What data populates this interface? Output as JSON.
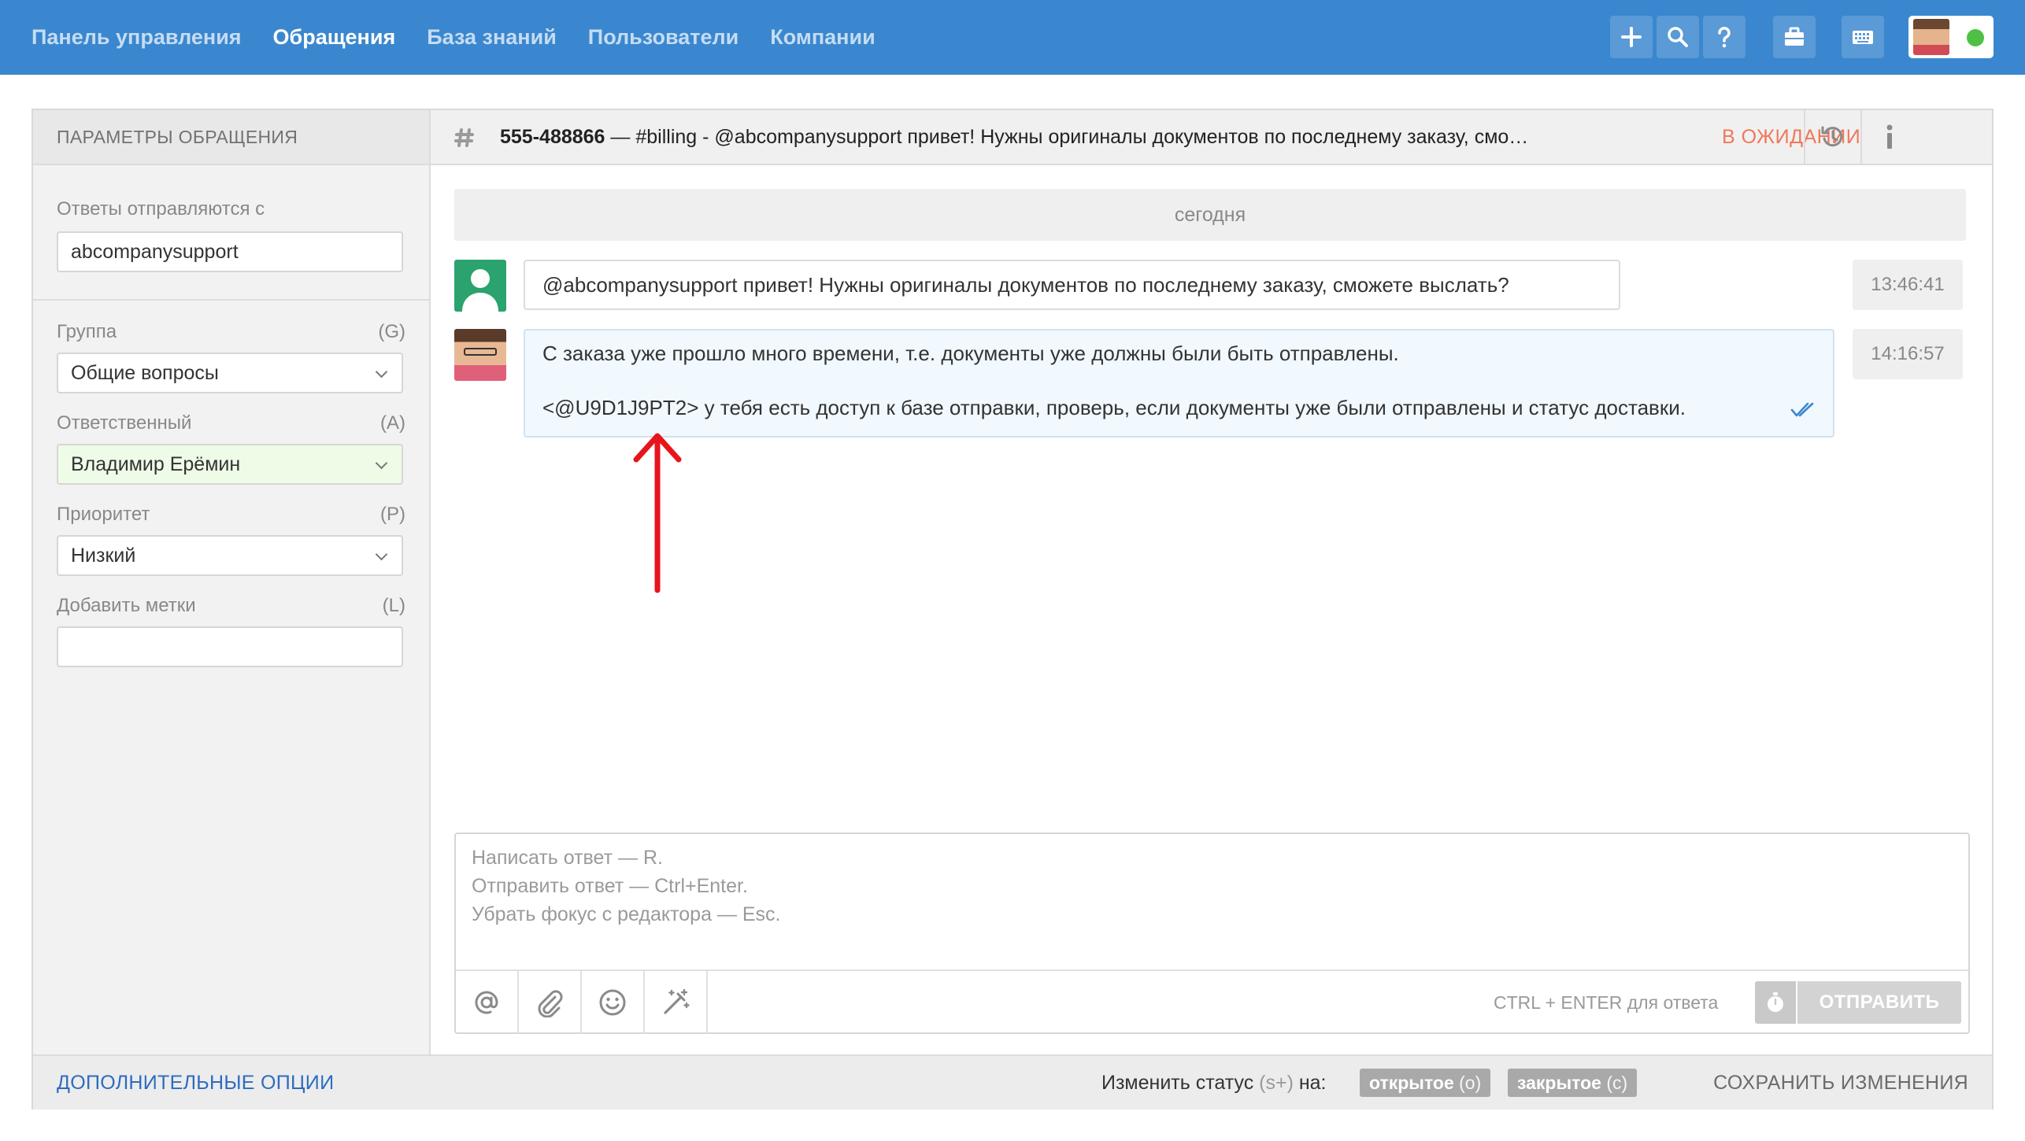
{
  "nav": {
    "items": [
      "Панель управления",
      "Обращения",
      "База знаний",
      "Пользователи",
      "Компании"
    ],
    "active_index": 1
  },
  "toolbar": {
    "icons": [
      "plus-icon",
      "search-icon",
      "help-icon",
      "briefcase-icon",
      "keyboard-icon"
    ],
    "user_status_color": "#4ec144"
  },
  "sidebar": {
    "title": "ПАРАМЕТРЫ ОБРАЩЕНИЯ",
    "reply_from_label": "Ответы отправляются с",
    "reply_from_value": "abcompanysupport",
    "group_label": "Группа",
    "group_key": "(G)",
    "group_value": "Общие вопросы",
    "assignee_label": "Ответственный",
    "assignee_key": "(A)",
    "assignee_value": "Владимир Ерёмин",
    "priority_label": "Приоритет",
    "priority_key": "(P)",
    "priority_value": "Низкий",
    "tags_label": "Добавить метки",
    "tags_key": "(L)",
    "tags_value": ""
  },
  "ticket": {
    "id": "555-488866",
    "subject": " — #billing - @abcompanysupport привет! Нужны оригиналы документов по последнему заказу, смо…",
    "status": "В ОЖИДАНИИ"
  },
  "chat": {
    "day_label": "сегодня",
    "messages": [
      {
        "lines": [
          "@abcompanysupport привет! Нужны оригиналы документов по последнему заказу, сможете выслать?"
        ],
        "time": "13:46:41"
      },
      {
        "lines": [
          "С заказа уже прошло много времени, т.е. документы уже должны были быть отправлены.",
          "<@U9D1J9PT2> у тебя есть доступ к базе отправки, проверь, если документы уже были отправлены и статус доставки."
        ],
        "time": "14:16:57"
      }
    ]
  },
  "editor": {
    "placeholder_lines": [
      "Написать ответ — R.",
      "Отправить ответ — Ctrl+Enter.",
      "Убрать фокус с редактора — Esc."
    ],
    "tool_icons": [
      "mention-icon",
      "paperclip-icon",
      "emoji-icon",
      "magic-wand-icon"
    ],
    "hint": "CTRL + ENTER для ответа",
    "send_label": "ОТПРАВИТЬ"
  },
  "footer": {
    "more_options": "ДОПОЛНИТЕЛЬНЫЕ ОПЦИИ",
    "change_status_prefix": "Изменить статус ",
    "change_status_key": "(s+)",
    "change_status_suffix": " на:",
    "status_open": "открытое",
    "status_open_key": "(o)",
    "status_closed": "закрытое",
    "status_closed_key": "(c)",
    "save": "СОХРАНИТЬ ИЗМЕНЕНИЯ"
  },
  "colors": {
    "topbar": "#3a87cf",
    "status_pending": "#f0775a",
    "annotation_arrow": "#e8141c",
    "link": "#2d6cbf"
  }
}
